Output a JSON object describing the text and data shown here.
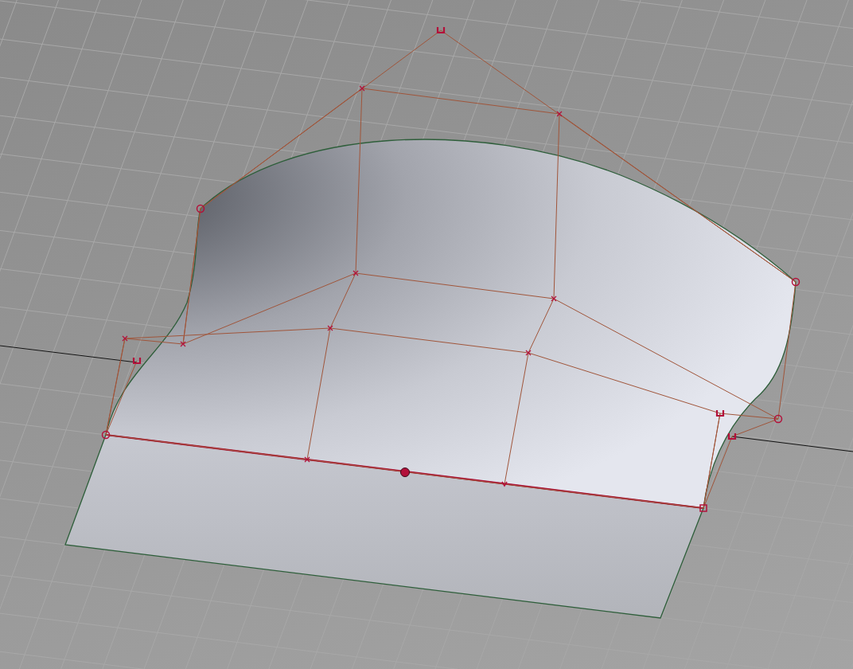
{
  "viewport": {
    "grid_visible": true,
    "control_net_visible": true,
    "edge_selected": true
  }
}
